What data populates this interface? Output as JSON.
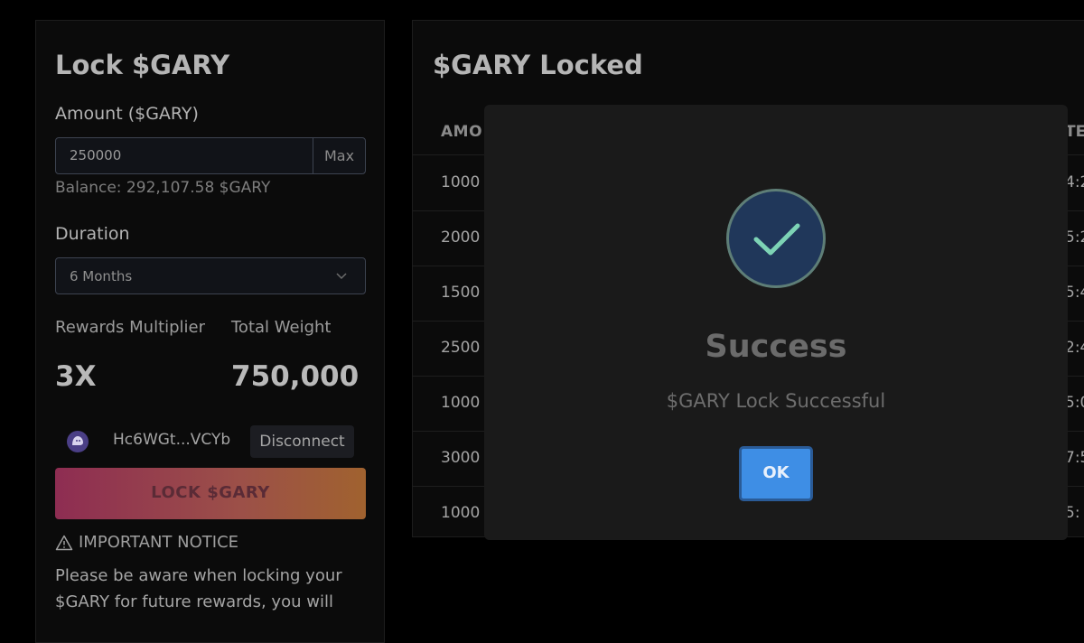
{
  "lock_panel": {
    "title": "Lock $GARY",
    "amount_label": "Amount ($GARY)",
    "amount_value": "250000",
    "max_label": "Max",
    "balance": "Balance: 292,107.58 $GARY",
    "duration_label": "Duration",
    "duration_value": "6 Months",
    "multiplier_label": "Rewards Multiplier",
    "multiplier_value": "3X",
    "weight_label": "Total Weight",
    "weight_value": "750,000",
    "wallet_address": "Hc6WGt...VCYb",
    "disconnect_label": "Disconnect",
    "lock_button": "LOCK $GARY",
    "notice_title": "IMPORTANT NOTICE",
    "notice_body": "Please be aware when locking your $GARY for future rewards, you will"
  },
  "locked_panel": {
    "title": "$GARY Locked",
    "col_amount": "AMO",
    "col_right": "TE",
    "rows": [
      {
        "amount": "1000",
        "right": "4:2"
      },
      {
        "amount": "2000",
        "right": "5:2"
      },
      {
        "amount": "1500",
        "right": "5:4"
      },
      {
        "amount": "2500",
        "right": "2:4"
      },
      {
        "amount": "1000",
        "right": "5:0"
      },
      {
        "amount": "3000",
        "right": "7:5"
      },
      {
        "amount": "1000",
        "right": "5:"
      }
    ]
  },
  "modal": {
    "title": "Success",
    "message": "$GARY Lock Successful",
    "ok_label": "OK"
  },
  "icons": {
    "success": "check-circle-icon",
    "chevron": "chevron-down-icon",
    "warning": "warning-triangle-icon",
    "wallet": "wallet-avatar-icon"
  },
  "colors": {
    "accent_blue": "#3e8ee5",
    "lock_gradient_start": "#8e2d52",
    "lock_gradient_end": "#a0622f",
    "check_stroke": "#7dd3b5"
  }
}
